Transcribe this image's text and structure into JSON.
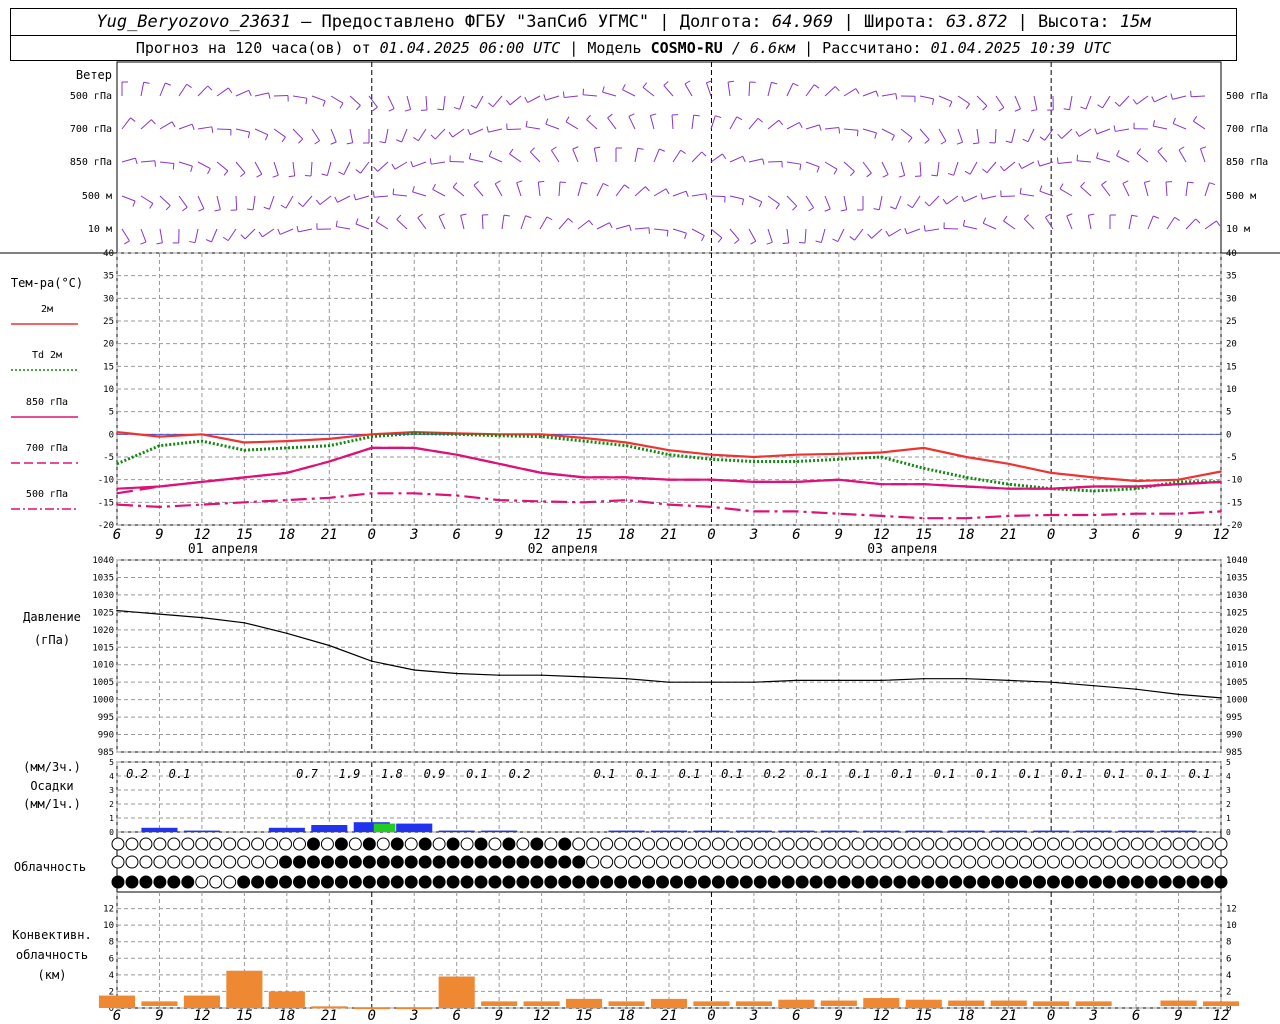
{
  "header": {
    "station": "Yug_Beryozovo_23631",
    "provider": " – Предоставлено ФГБУ \"ЗапСиб УГМС\" | Долгота: ",
    "lon": "64.969",
    "lat_label": " | Широта: ",
    "lat": "63.872",
    "alt_label": " | Высота: ",
    "alt": "15м",
    "forecast_prefix": "Прогноз на 120 часа(ов) от ",
    "forecast_time": "01.04.2025 06:00 UTC",
    "model_label": "  | Модель ",
    "model": "COSMO-RU",
    "model_res": " / 6.6км",
    "calc_label": " | Рассчитано: ",
    "calc_time": "01.04.2025 10:39 UTC"
  },
  "panels": {
    "wind": {
      "title": "Ветер",
      "levels": [
        "500 гПа",
        "700 гПа",
        "850 гПа",
        "500 м",
        "10  м"
      ]
    },
    "temperature": {
      "title": "Тем-ра(°C)",
      "legend": [
        {
          "label": "2м",
          "color": "#ee3333",
          "style": "solid"
        },
        {
          "label": "Td  2м",
          "color": "#118811",
          "style": "dotted"
        },
        {
          "label": "850 гПа",
          "color": "#dd1177",
          "style": "solid"
        },
        {
          "label": "700 гПа",
          "color": "#dd1177",
          "style": "dash"
        },
        {
          "label": "500 гПа",
          "color": "#dd1177",
          "style": "dashdot"
        }
      ],
      "ticks": [
        40,
        35,
        30,
        25,
        20,
        15,
        10,
        5,
        0,
        -5,
        -10,
        -15,
        -20
      ]
    },
    "time_axis": {
      "hours": [
        "6",
        "9",
        "12",
        "15",
        "18",
        "21",
        "0",
        "3",
        "6",
        "9",
        "12",
        "15",
        "18",
        "21",
        "0",
        "3",
        "6",
        "9",
        "12",
        "15",
        "18",
        "21",
        "0",
        "3",
        "6",
        "9",
        "12"
      ],
      "dates": [
        "01 апреля",
        "02 апреля",
        "03 апреля"
      ]
    },
    "pressure": {
      "title": "Давление",
      "unit": "(гПа)",
      "ticks": [
        1040,
        1035,
        1030,
        1025,
        1020,
        1015,
        1010,
        1005,
        1000,
        995,
        990,
        985
      ]
    },
    "precip": {
      "unit_top": "(мм/3ч.)",
      "title": "Осадки",
      "unit_bottom": "(мм/1ч.)",
      "ticks": [
        5,
        4,
        3,
        2,
        1,
        0
      ],
      "totals": [
        "0.2",
        "0.1",
        "",
        "",
        "0.7",
        "1.9",
        "1.8",
        "0.9",
        "0.1",
        "0.2",
        "",
        "0.1",
        "0.1",
        "0.1",
        "0.1",
        "0.2",
        "0.1",
        "0.1",
        "0.1",
        "0.1",
        "0.1",
        "0.1",
        "0.1",
        "0.1",
        "0.1",
        "0.1"
      ]
    },
    "cloud": {
      "title": "Облачность"
    },
    "convective": {
      "title_1": "Конвективн.",
      "title_2": "облачность",
      "title_3": "(км)",
      "ticks": [
        12,
        10,
        8,
        6,
        4,
        2,
        0
      ]
    }
  },
  "chart_data": [
    {
      "type": "line",
      "title": "Тем-ра(°C)",
      "x_hours": [
        0,
        3,
        6,
        9,
        12,
        15,
        18,
        21,
        24,
        27,
        30,
        33,
        36,
        39,
        42,
        45,
        48,
        51,
        54,
        57,
        60,
        63,
        66,
        69,
        72,
        75,
        78
      ],
      "ylim": [
        -20,
        40
      ],
      "series": [
        {
          "name": "2м",
          "values": [
            0.5,
            -0.5,
            0,
            -1.8,
            -1.5,
            -1,
            0,
            0.5,
            0.2,
            0,
            0,
            -0.8,
            -1.8,
            -3.5,
            -4.5,
            -5,
            -4.5,
            -4.3,
            -4,
            -3,
            -5,
            -6.5,
            -8.5,
            -9.5,
            -10.3,
            -10,
            -8.2
          ]
        },
        {
          "name": "Td  2м",
          "values": [
            -6.5,
            -2.5,
            -1.5,
            -3.5,
            -3,
            -2.5,
            -0.5,
            0.2,
            0,
            -0.3,
            -0.5,
            -1.5,
            -2.5,
            -4.5,
            -5.5,
            -6,
            -6,
            -5.5,
            -5,
            -7.5,
            -9.5,
            -11,
            -12,
            -12.5,
            -12,
            -10.5,
            -10.5
          ]
        },
        {
          "name": "850 гПа",
          "values": [
            -12,
            -11.5,
            -10.5,
            -9.5,
            -8.5,
            -6,
            -3,
            -3,
            -4.5,
            -6.5,
            -8.5,
            -9.5,
            -9.5,
            -10,
            -10,
            -10.5,
            -10.5,
            -10,
            -11,
            -11,
            -11.5,
            -12,
            -12,
            -11.5,
            -11.5,
            -11,
            -10.5
          ]
        },
        {
          "name": "700 гПа",
          "values": [
            -13,
            -11.5,
            -10.5,
            -9.5,
            -8.5,
            -6,
            -3,
            -3,
            -4.5,
            -6.5,
            -8.5,
            -9.5,
            -9.5,
            -10,
            -10,
            -10.5,
            -10.5,
            -10,
            -11,
            -11,
            -11.5,
            -12,
            -12,
            -11.5,
            -11.5,
            -11,
            -10.5
          ]
        },
        {
          "name": "500 гПа",
          "values": [
            -15.5,
            -16,
            -15.5,
            -15,
            -14.5,
            -14,
            -13,
            -13,
            -13.5,
            -14.5,
            -14.8,
            -15,
            -14.5,
            -15.5,
            -16,
            -17,
            -17,
            -17.5,
            -18,
            -18.5,
            -18.5,
            -18,
            -17.8,
            -17.8,
            -17.5,
            -17.5,
            -17
          ]
        }
      ]
    },
    {
      "type": "line",
      "title": "Давление",
      "x_hours": [
        0,
        3,
        6,
        9,
        12,
        15,
        18,
        21,
        24,
        27,
        30,
        33,
        36,
        39,
        42,
        45,
        48,
        51,
        54,
        57,
        60,
        63,
        66,
        69,
        72,
        75,
        78
      ],
      "ylim": [
        985,
        1040
      ],
      "series": [
        {
          "name": "Давление",
          "values": [
            1025.5,
            1024.5,
            1023.5,
            1022,
            1019,
            1015.5,
            1011,
            1008.5,
            1007.5,
            1007,
            1007,
            1006.5,
            1006,
            1005,
            1005,
            1005,
            1005.5,
            1005.5,
            1005.5,
            1006,
            1006,
            1005.5,
            1005,
            1004,
            1003,
            1001.5,
            1000.5
          ]
        }
      ]
    },
    {
      "type": "bar",
      "title": "Осадки",
      "x_hours": [
        0,
        3,
        6,
        9,
        12,
        15,
        18,
        21,
        24,
        27,
        30,
        33,
        36,
        39,
        42,
        45,
        48,
        51,
        54,
        57,
        60,
        63,
        66,
        69,
        72,
        75,
        78
      ],
      "ylim": [
        0,
        5
      ],
      "series": [
        {
          "name": "(мм/1ч.)",
          "values": [
            0,
            0.3,
            0.1,
            0,
            0.3,
            0.5,
            0.7,
            0.6,
            0.1,
            0.1,
            0,
            0,
            0.1,
            0.1,
            0.1,
            0.1,
            0.1,
            0.1,
            0.1,
            0.1,
            0.1,
            0.1,
            0.1,
            0.1,
            0.1,
            0.1,
            0
          ]
        },
        {
          "name": "snow",
          "values": [
            0,
            0,
            0,
            0,
            0,
            0,
            0.6,
            0,
            0,
            0,
            0,
            0,
            0,
            0,
            0,
            0,
            0,
            0,
            0,
            0,
            0,
            0,
            0,
            0,
            0,
            0,
            0
          ]
        }
      ]
    },
    {
      "type": "bar",
      "title": "Конвективн. облачность",
      "x_hours": [
        0,
        3,
        6,
        9,
        12,
        15,
        18,
        21,
        24,
        27,
        30,
        33,
        36,
        39,
        42,
        45,
        48,
        51,
        54,
        57,
        60,
        63,
        66,
        69,
        72,
        75,
        78
      ],
      "ylim": [
        0,
        14
      ],
      "series": [
        {
          "name": "(км)",
          "values": [
            1.5,
            0.8,
            1.5,
            4.5,
            2,
            0.2,
            0.1,
            0.1,
            3.8,
            0.8,
            0.8,
            1.1,
            0.8,
            1.1,
            0.8,
            0.8,
            1,
            0.9,
            1.2,
            1,
            0.9,
            0.9,
            0.8,
            0.8,
            0,
            0.9,
            0.8
          ]
        }
      ]
    }
  ]
}
